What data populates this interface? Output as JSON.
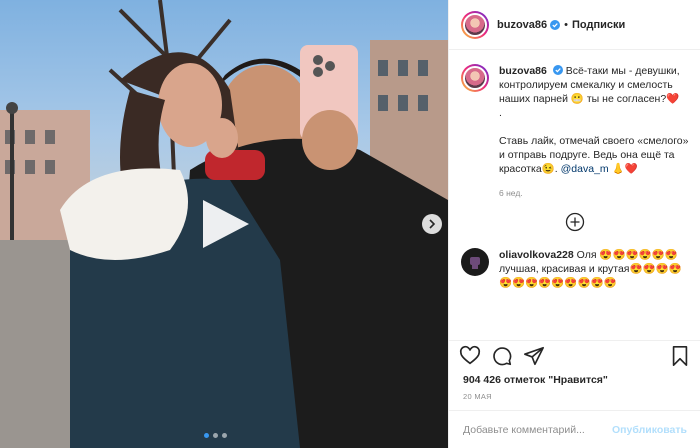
{
  "post": {
    "author": "buzova86",
    "follow_label": "Подписки",
    "separator": "•",
    "caption_line1": "Всё-таки мы - девушки, контролируем смекалку и смелость наших парней 😬 ты не согласен?❤️",
    "caption_dot": ".",
    "caption_line2": "Ставь лайк, отмечай своего «смелого» и отправь подруге. Ведь она ещё та красотка😉.",
    "mention": "@dava_m",
    "caption_tail": " 👃❤️",
    "age": "6 нед."
  },
  "comment": {
    "author": "oliavolkova228",
    "text": "Оля 😍😍😍😍😍😍 лучшая, красивая и крутая😍😍😍😍😍😍😍😍😍😍😍😍😍"
  },
  "likes_text": "904 426 отметок \"Нравится\"",
  "date_text": "20 МАЯ",
  "comment_input": {
    "placeholder": "Добавьте комментарий...",
    "publish_label": "Опубликовать"
  },
  "carousel": {
    "slides": 3,
    "active": 1
  },
  "colors": {
    "accent": "#3897f0",
    "publish_disabled": "#b2dffc",
    "text": "#262626",
    "muted": "#8e8e8e"
  },
  "icons": [
    "play-icon",
    "next-arrow-icon",
    "verified-icon",
    "add-circle-icon",
    "heart-icon",
    "comment-icon",
    "share-icon",
    "bookmark-icon",
    "fist-icon"
  ]
}
